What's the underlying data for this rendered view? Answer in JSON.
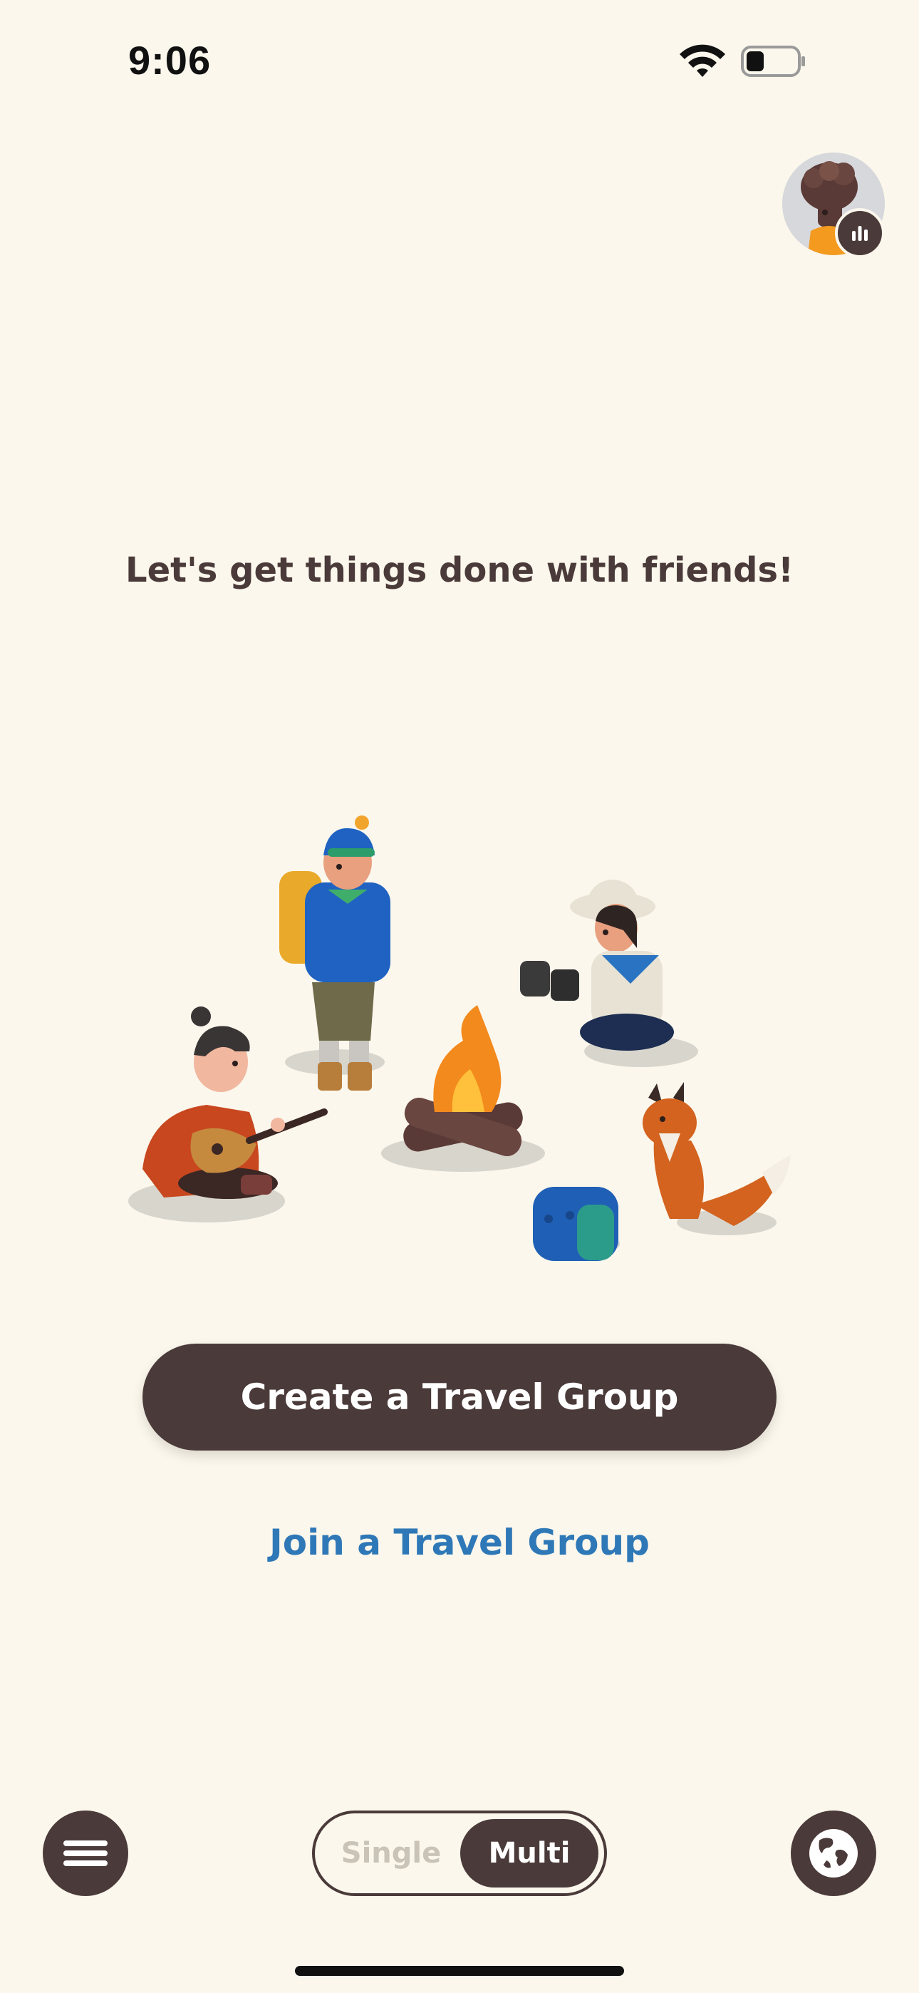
{
  "status_bar": {
    "time": "9:06"
  },
  "headline": "Let's get things done with friends!",
  "actions": {
    "create_label": "Create a Travel Group",
    "join_label": "Join a Travel Group"
  },
  "mode_toggle": {
    "options": [
      "Single",
      "Multi"
    ],
    "selected": "Multi"
  },
  "icons": {
    "menu": "hamburger-menu-icon",
    "globe": "globe-icon",
    "avatar_badge": "stats-bars-icon",
    "wifi": "wifi-icon",
    "battery": "battery-icon"
  },
  "colors": {
    "background": "#FBF7EC",
    "primary_dark": "#4A3A39",
    "link_blue": "#2F78B7",
    "inactive_text": "#C9C3B8"
  }
}
